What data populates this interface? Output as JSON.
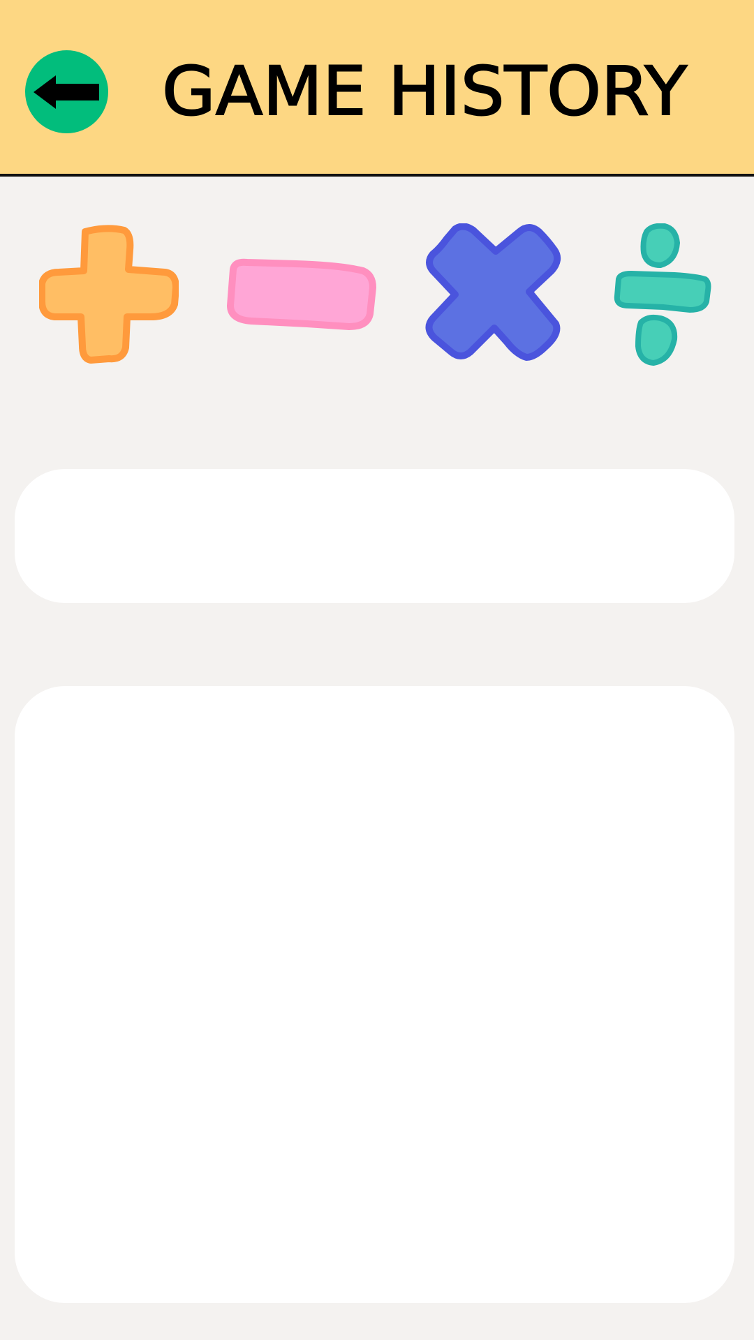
{
  "header": {
    "title": "GAME HISTORY",
    "background_color": "#fdd783",
    "back_button": {
      "icon": "arrow-left-icon",
      "color": "#02bd7c"
    }
  },
  "operations": [
    {
      "name": "plus",
      "icon": "plus-icon",
      "fill": "#ffbe64",
      "stroke": "#ff9a3c"
    },
    {
      "name": "minus",
      "icon": "minus-icon",
      "fill": "#ffa6d6",
      "stroke": "#ff8fbf"
    },
    {
      "name": "multiply",
      "icon": "multiply-icon",
      "fill": "#5c71e2",
      "stroke": "#4a54dd"
    },
    {
      "name": "divide",
      "icon": "divide-icon",
      "fill": "#47cfb7",
      "stroke": "#26b2a7"
    }
  ],
  "panels": {
    "summary": "",
    "history_list": ""
  }
}
